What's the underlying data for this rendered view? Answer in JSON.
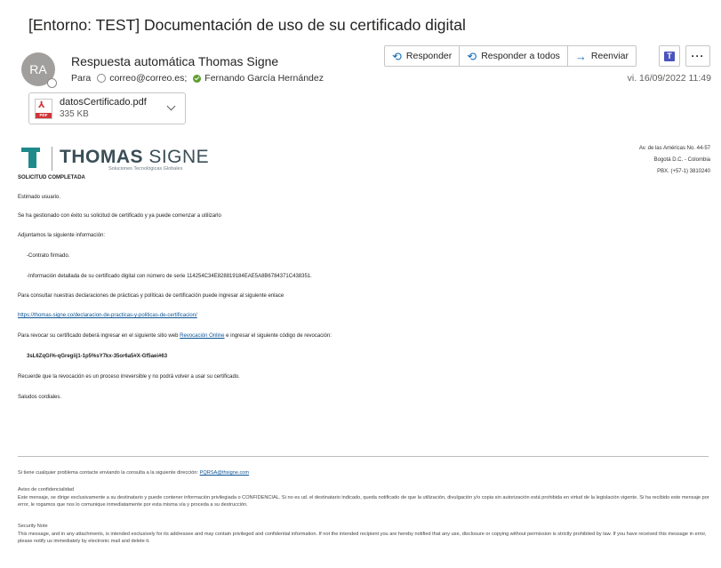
{
  "email": {
    "subject": "[Entorno: TEST] Documentación de uso de su certificado digital",
    "avatar_initials": "RA",
    "sender": "Respuesta automática Thomas Signe",
    "to_label": "Para",
    "recipients": [
      "correo@correo.es;",
      "Fernando García Hernández"
    ],
    "date": "vi. 16/09/2022 11:49"
  },
  "actions": {
    "reply": "Responder",
    "reply_all": "Responder a todos",
    "forward": "Reenviar"
  },
  "attachment": {
    "name": "datosCertificado.pdf",
    "size": "335 KB",
    "type_label": "PDF"
  },
  "logo": {
    "name_bold": "THOMAS",
    "name_light": "SIGNE",
    "tagline": "Soluciones Tecnológicas Globales"
  },
  "address": [
    "Av. de las Américas No. 44-57",
    "Bogotá D.C. - Colombia",
    "PBX. (+57-1) 3810240"
  ],
  "body": {
    "heading": "SOLICITUD COMPLETADA",
    "greeting": "Estimado usuario.",
    "p1": "Se ha gestionado con éxito su solicitud de certificado y ya puede comenzar a utilizarlo",
    "p2": "Adjuntamos la siguiente información:",
    "item1": "-Contrato firmado.",
    "item2_prefix": "-Información detallada de su certificado digital con número de serie",
    "serial": "114254C34E828819184EAE5A8B6784371C438351.",
    "p3": "Para consultar nuestras declaraciones de prácticas y políticas de certificación puede ingresar al siguiente enlace",
    "link1": "https://thomas-signe.co/declaracion-de-practicas-y-politicas-de-certificacion/",
    "p4_prefix": "Para revocar su certificado deberá ingresar en el siguiente sitio web",
    "link2": "Revocación Online",
    "p4_suffix": "e ingresar el siguiente código de revocación:",
    "code": "3sL6ZqGi%-qGregiij1-1p5%sY7kx-35or6a5#X-Gf5aei#63",
    "p5": "Recuerde que la revocación es un proceso irreversible y no podrá volver a usar su certificado.",
    "closing": "Saludos cordiales."
  },
  "footer": {
    "contact_prefix": "Si tiene cualquier problema contacte enviando la consulta a la siguiente dirección:",
    "contact_email": "PQRSA@thsigne.com",
    "conf_title": "Aviso de confidencialidad",
    "conf_text": "Este mensaje, se dirige exclusivamente a su destinatario y puede contener información privilegiada o CONFIDENCIAL. Si no es ud. el destinatario indicado, queda notificado de que la utilización, divulgación y/o copia sin autorización está prohibida en virtud de la legislación vigente. Si ha recibido este mensaje por error, le rogamos que nos lo comunique inmediatamente por esta misma vía y proceda a su destrucción.",
    "sec_title": "Security Note",
    "sec_text": "This message, and in any attachments, is intended exclusively for its addressee and may contain privileged and confidential information. If not the intended recipient you are hereby notified that any use, disclosure or copying without permission is strictly prohibited by law. If you have received this message in error, please notify us immediately by electronic mail and delete it."
  }
}
